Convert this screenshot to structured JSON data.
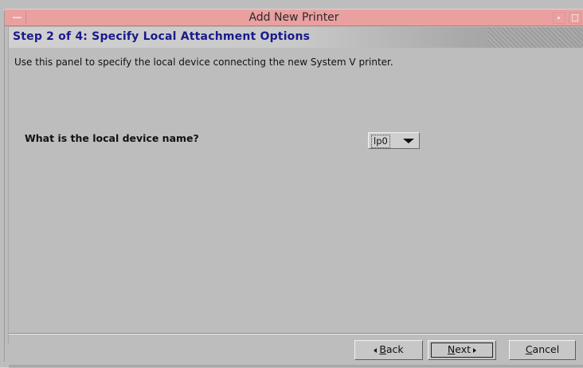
{
  "window": {
    "title": "Add New Printer",
    "titlebar_color": "#eba0a0"
  },
  "step": {
    "title": "Step 2 of 4: Specify Local Attachment Options",
    "title_color": "#1a1a8c"
  },
  "panel": {
    "description": "Use this panel to specify the local device connecting the new System V printer.",
    "question": "What is the local device name?",
    "device_select": {
      "value": "lp0"
    }
  },
  "buttons": {
    "back": {
      "mnemonic": "B",
      "rest": "ack"
    },
    "next": {
      "mnemonic": "N",
      "rest": "ext"
    },
    "cancel": {
      "mnemonic": "C",
      "rest": "ancel"
    }
  },
  "icons": {
    "window_menu": "window-menu-icon",
    "minimize": "minimize-icon",
    "maximize": "maximize-icon",
    "dropdown": "chevron-down-icon",
    "back": "arrow-left-icon",
    "next": "arrow-right-icon"
  }
}
